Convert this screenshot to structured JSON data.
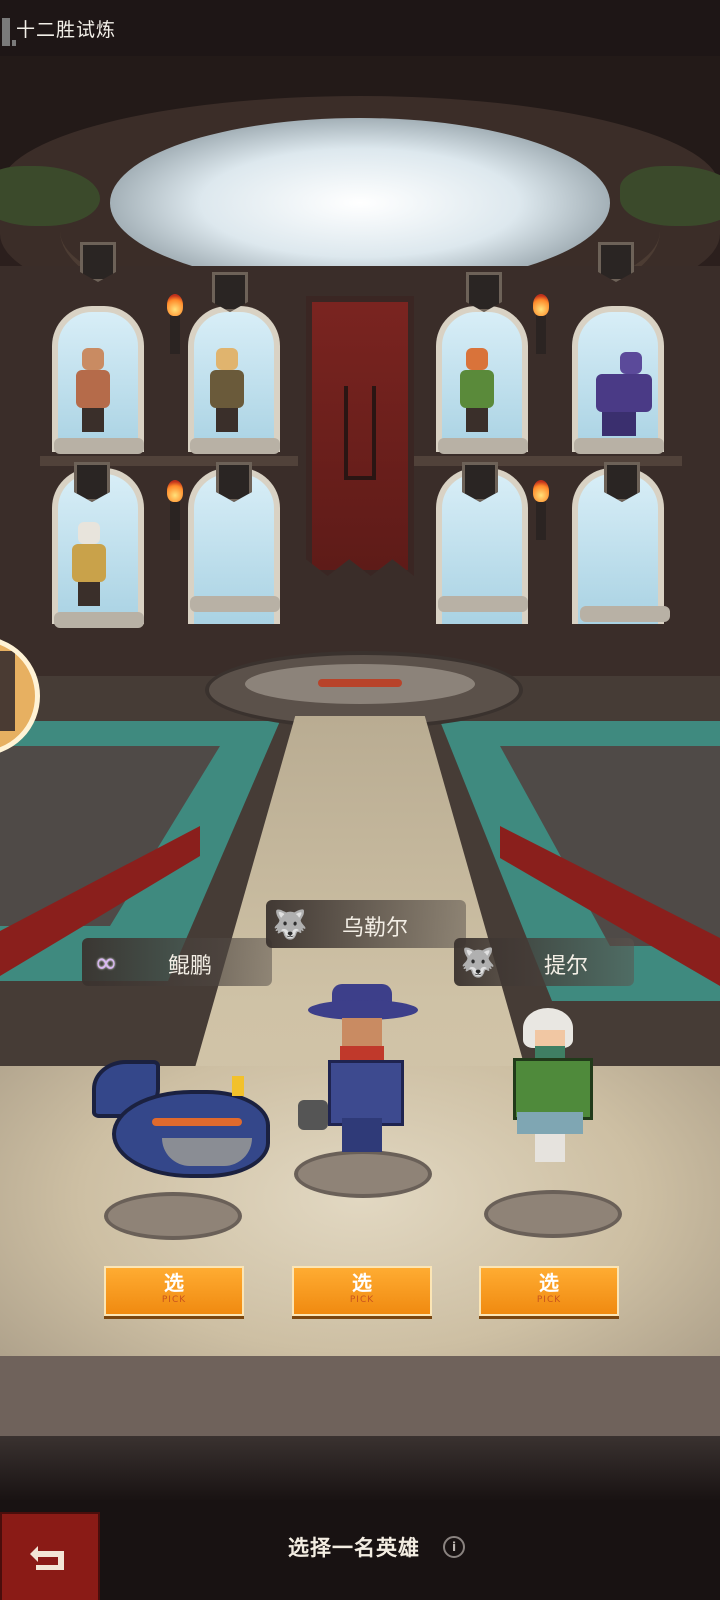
{
  "header": {
    "title": "十二胜试炼"
  },
  "candidates": [
    {
      "name": "鲲鹏",
      "faction_icon": "infinity-icon",
      "pick_label": "选",
      "pick_sub": "PICK"
    },
    {
      "name": "乌勒尔",
      "faction_icon": "wolf-icon",
      "pick_label": "选",
      "pick_sub": "PICK"
    },
    {
      "name": "提尔",
      "faction_icon": "wolf-icon",
      "pick_label": "选",
      "pick_sub": "PICK"
    }
  ],
  "footer": {
    "prompt": "选择一名英雄",
    "info_symbol": "i",
    "back_icon": "back-arrow-icon"
  },
  "colors": {
    "pick_button": "#f59a1e",
    "back_button": "#8a1b16",
    "faction_infinity": "#d9b8f2",
    "faction_wolf": "#bfe6ee"
  }
}
